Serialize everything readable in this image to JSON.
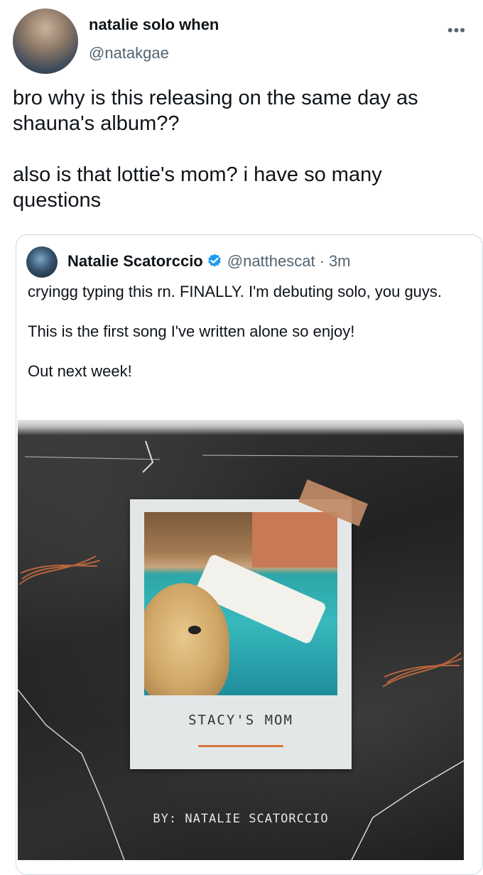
{
  "tweet": {
    "display_name": "natalie solo when",
    "handle": "@natakgae",
    "text": "bro why is this releasing on the same day as shauna's album??\n\nalso is that lottie's mom? i have so many questions",
    "more_icon": "ellipsis-icon"
  },
  "quote": {
    "name": "Natalie Scatorccio",
    "handle": "@natthescat",
    "separator": "·",
    "time": "3m",
    "verified_icon": "verified-badge-icon",
    "verified_color": "#1d9bf0",
    "text": "cryingg typing this rn. FINALLY. I'm debuting solo, you guys.\n\nThis is the first song I've written alone so enjoy!\n\nOut next week!"
  },
  "cover": {
    "song_title": "STACY'S MOM",
    "byline": "BY: NATALIE SCATORCCIO",
    "accent_color": "#d9733e"
  }
}
